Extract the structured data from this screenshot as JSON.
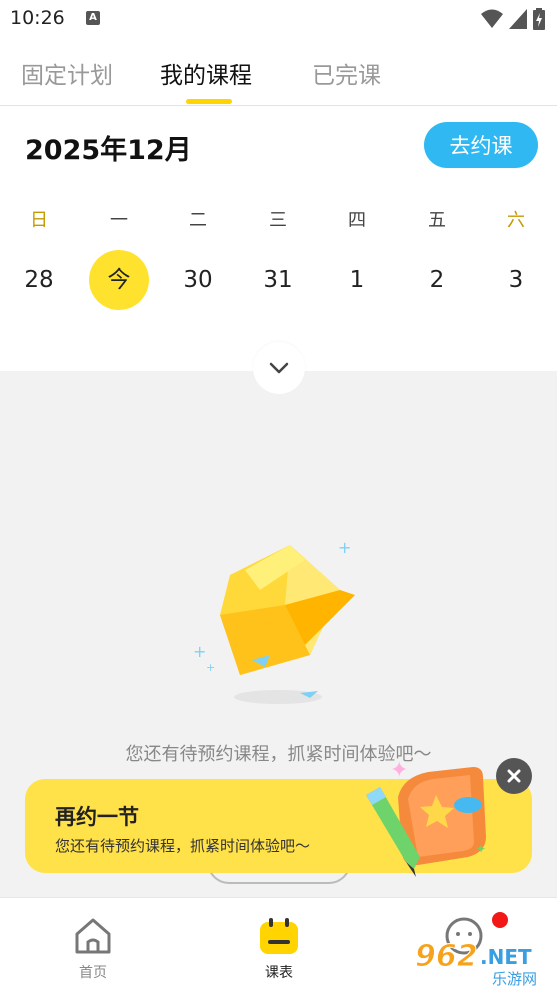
{
  "status_bar": {
    "time": "10:26",
    "notification_icon": "a-icon",
    "icons": [
      "wifi-icon",
      "signal-icon",
      "battery-charging-icon"
    ]
  },
  "tabs": [
    {
      "label": "固定计划",
      "active": false
    },
    {
      "label": "我的课程",
      "active": true
    },
    {
      "label": "已完课",
      "active": false
    }
  ],
  "calendar": {
    "month_title": "2025年12月",
    "book_button": "去约课",
    "weekdays": [
      "日",
      "一",
      "二",
      "三",
      "四",
      "五",
      "六"
    ],
    "dates": [
      "28",
      "今",
      "30",
      "31",
      "1",
      "2",
      "3"
    ],
    "today_index": 1
  },
  "empty_state": {
    "message": "您还有待预约课程，抓紧时间体验吧～",
    "icon": "empty-box-icon"
  },
  "promo": {
    "title": "再约一节",
    "subtitle": "您还有待预约课程，抓紧时间体验吧～",
    "close_icon": "close-icon"
  },
  "tabbar": [
    {
      "label": "首页",
      "icon": "home-icon"
    },
    {
      "label": "课表",
      "icon": "schedule-icon"
    },
    {
      "label": "",
      "icon": "profile-icon"
    }
  ],
  "watermark": {
    "text": "962.NET",
    "sub": "乐游网"
  },
  "colors": {
    "accent_yellow": "#ffd400",
    "book_blue": "#2fb8f2",
    "badge_red": "#f21818"
  }
}
